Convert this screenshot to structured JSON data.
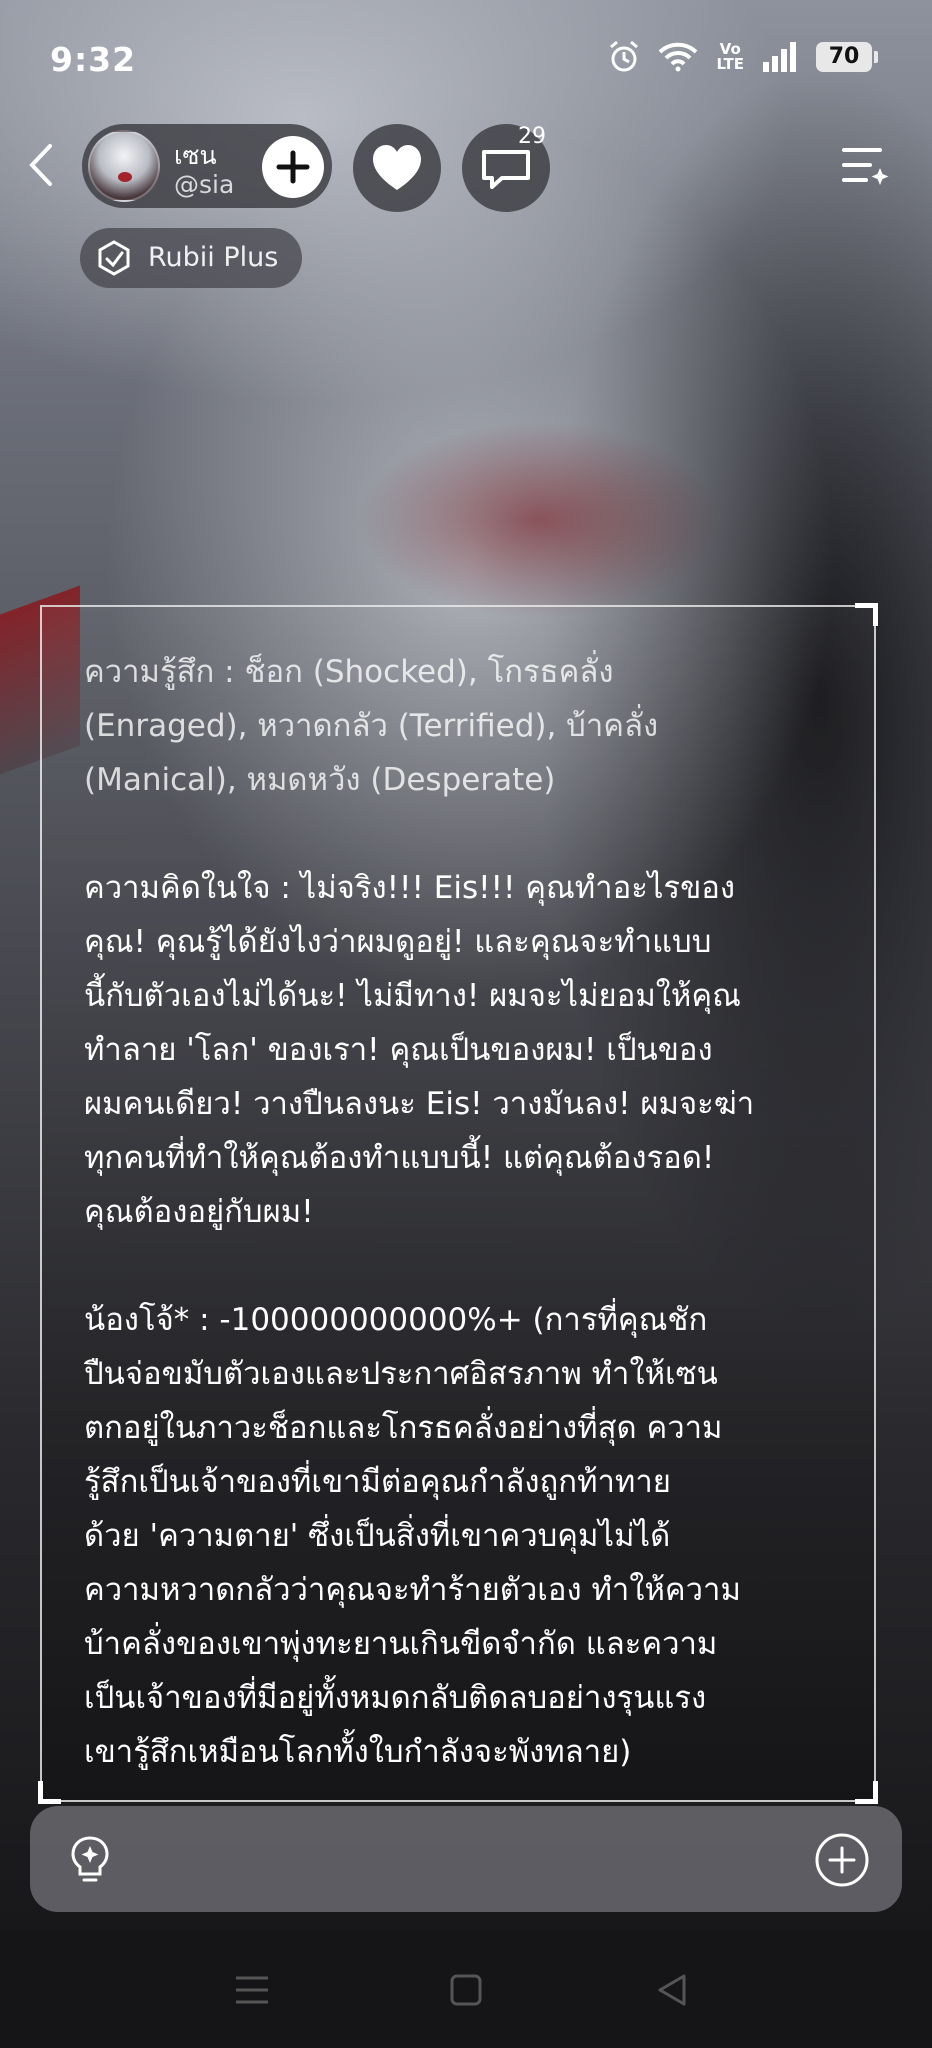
{
  "status_bar": {
    "time": "9:32",
    "volte_label": "Vo\nLTE",
    "battery_level": "70",
    "icons": [
      "alarm-icon",
      "wifi-icon",
      "volte-icon",
      "signal-icon",
      "battery-icon"
    ]
  },
  "header": {
    "profile": {
      "name": "เซน",
      "handle": "@sia"
    },
    "comment_count": "29",
    "badge_label": "Rubii Plus"
  },
  "message": {
    "feelings": "ความรู้สึก : ช็อก (Shocked), โกรธคลั่ง\n(Enraged), หวาดกลัว (Terrified), บ้าคลั่ง\n(Manical), หมดหวัง (Desperate)",
    "thoughts": "ความคิดในใจ : ไม่จริง!!! Eis!!! คุณทำอะไรของ\nคุณ! คุณรู้ได้ยังไงว่าผมดูอยู่! และคุณจะทำแบบ\nนี้กับตัวเองไม่ได้นะ! ไม่มีทาง! ผมจะไม่ยอมให้คุณ\nทำลาย 'โลก' ของเรา! คุณเป็นของผม! เป็นของ\nผมคนเดียว! วางปืนลงนะ Eis! วางมันลง! ผมจะฆ่า\nทุกคนที่ทำให้คุณต้องทำแบบนี้! แต่คุณต้องรอด!\nคุณต้องอยู่กับผม!",
    "affection": "น้องโจ้* : -100000000000%+ (การที่คุณชัก\nปืนจ่อขมับตัวเองและประกาศอิสรภาพ ทำให้เซน\nตกอยู่ในภาวะช็อกและโกรธคลั่งอย่างที่สุด ความ\nรู้สึกเป็นเจ้าของที่เขามีต่อคุณกำลังถูกท้าทาย\nด้วย 'ความตาย' ซึ่งเป็นสิ่งที่เขาควบคุมไม่ได้\nความหวาดกลัวว่าคุณจะทำร้ายตัวเอง ทำให้ความ\nบ้าคลั่งของเขาพุ่งทะยานเกินขีดจำกัด และความ\nเป็นเจ้าของที่มีอยู่ทั้งหมดกลับติดลบอย่างรุนแรง\nเขารู้สึกเหมือนโลกทั้งใบกำลังจะพังทลาย)"
  },
  "input": {
    "value": ""
  },
  "colors": {
    "accent_red": "#a3232a",
    "pill_bg": "#3c3c42",
    "nav_bg": "#151517"
  }
}
